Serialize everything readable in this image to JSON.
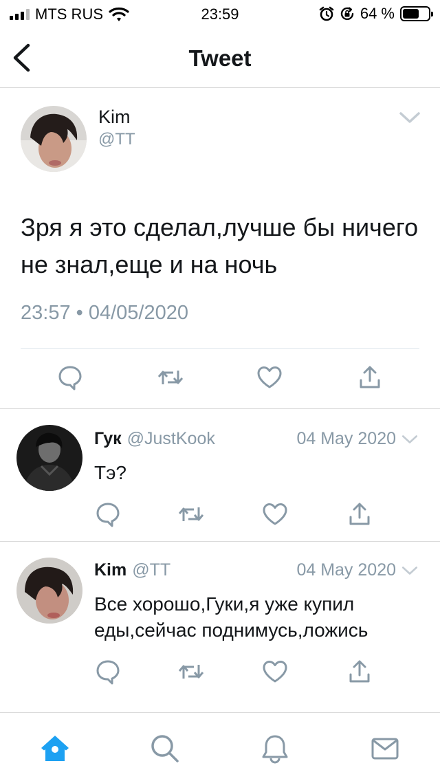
{
  "status_bar": {
    "carrier": "MTS RUS",
    "time": "23:59",
    "battery_percent": "64 %",
    "battery_level": 0.64,
    "icons": [
      "signal-icon",
      "wifi-icon",
      "alarm-icon",
      "orientation-lock-icon",
      "battery-icon"
    ]
  },
  "header": {
    "title": "Tweet",
    "back_icon": "chevron-left-icon"
  },
  "main_tweet": {
    "name": "Kim",
    "handle": "@TT",
    "text": "Зря я это сделал,лучше бы ничего не знал,еще и на ночь",
    "timestamp": "23:57 • 04/05/2020",
    "actions": [
      "reply-icon",
      "retweet-icon",
      "like-icon",
      "share-icon"
    ]
  },
  "replies": [
    {
      "name": "Гук",
      "handle": "@JustKook",
      "date": "04 May 2020",
      "text": "Тэ?"
    },
    {
      "name": "Kim",
      "handle": "@TT",
      "date": "04 May 2020",
      "text": "Все хорошо,Гуки,я уже купил еды,сейчас поднимусь,ложись"
    }
  ],
  "tabbar": {
    "items": [
      "home-icon",
      "search-icon",
      "notifications-icon",
      "messages-icon"
    ],
    "active_color": "#1da1f2",
    "inactive_color": "#8899a6"
  }
}
